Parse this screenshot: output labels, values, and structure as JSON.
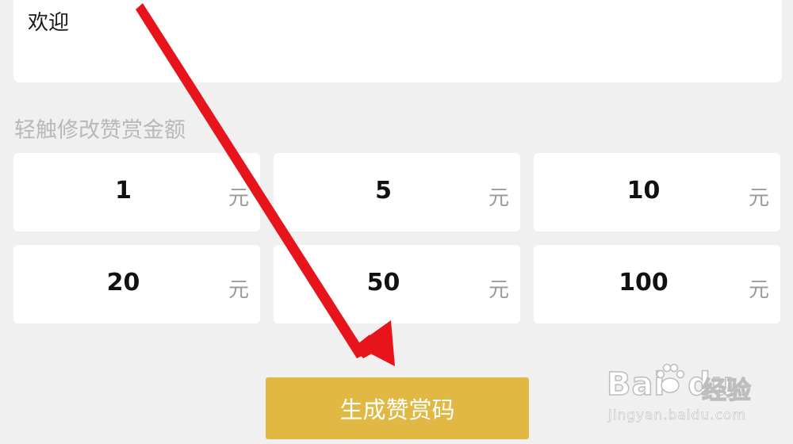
{
  "message": {
    "text": "欢迎"
  },
  "amount_section": {
    "label": "轻触修改赞赏金额",
    "unit": "元",
    "amounts": [
      "1",
      "5",
      "10",
      "20",
      "50",
      "100"
    ]
  },
  "actions": {
    "generate_label": "生成赞赏码"
  },
  "watermark": {
    "brand": "Bai",
    "brand_suffix": "du",
    "brand_cn": "经验",
    "url": "jingyan.baidu.com"
  },
  "colors": {
    "accent": "#e0b843",
    "arrow": "#e8141b",
    "background": "#f0f0f0"
  }
}
